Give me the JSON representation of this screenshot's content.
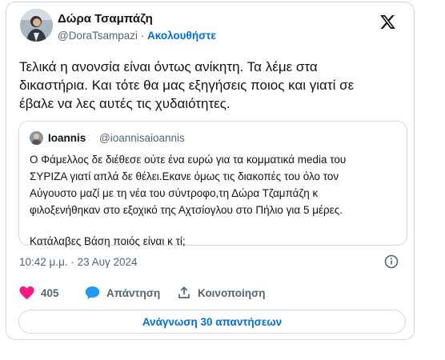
{
  "author": {
    "name": "Δώρα Τσαμπάζη",
    "handle": "@DoraTsampazi",
    "separator": "·",
    "follow_label": "Ακολουθήστε"
  },
  "icons": {
    "logo": "x-logo-icon",
    "info": "info-icon",
    "like": "heart-icon",
    "reply": "speech-bubble-icon",
    "share": "share-upload-icon"
  },
  "colors": {
    "accent": "#006fd6",
    "like": "#f91880",
    "reply": "#1d9bf0",
    "muted": "#536471",
    "border": "#cfd9de"
  },
  "tweet": {
    "lines": [
      "Τελικά η ανονσία είναι όντως ανίκητη. Τα λέμε στα",
      "δικαστήρια. Και τότε θα μας εξηγήσεις ποιος και γιατί σε",
      "έβαλε να λες αυτές τις χυδαιότητες."
    ]
  },
  "quoted": {
    "name": "Ioannis",
    "handle": "@ioannisaioannis",
    "lines": [
      "Ο Φάμελλος δε διέθεσε ούτε ένα ευρώ για τα κομματικά media του",
      "ΣΥΡΙΖΑ γιατί απλά δε θέλει.Εκανε όμως τις διακοπές του όλο τον",
      "Αύγουστο μαζί με τη νέα του σύντροφο,τη Δώρα Τζαμπάζη κ",
      "φιλοξενήθηκαν στο εξοχικό της Αχτσίογλου στο Πήλιο για 5 μέρες."
    ],
    "last_line": "Κατάλαβες Βάση ποιός είναι κ τί;"
  },
  "timestamp": "10:42 μ.μ. · 23 Αυγ 2024",
  "actions": {
    "likes": "405",
    "reply_label": "Απάντηση",
    "share_label": "Κοινοποίηση"
  },
  "read_replies_label": "Ανάγνωση 30 απαντήσεων"
}
